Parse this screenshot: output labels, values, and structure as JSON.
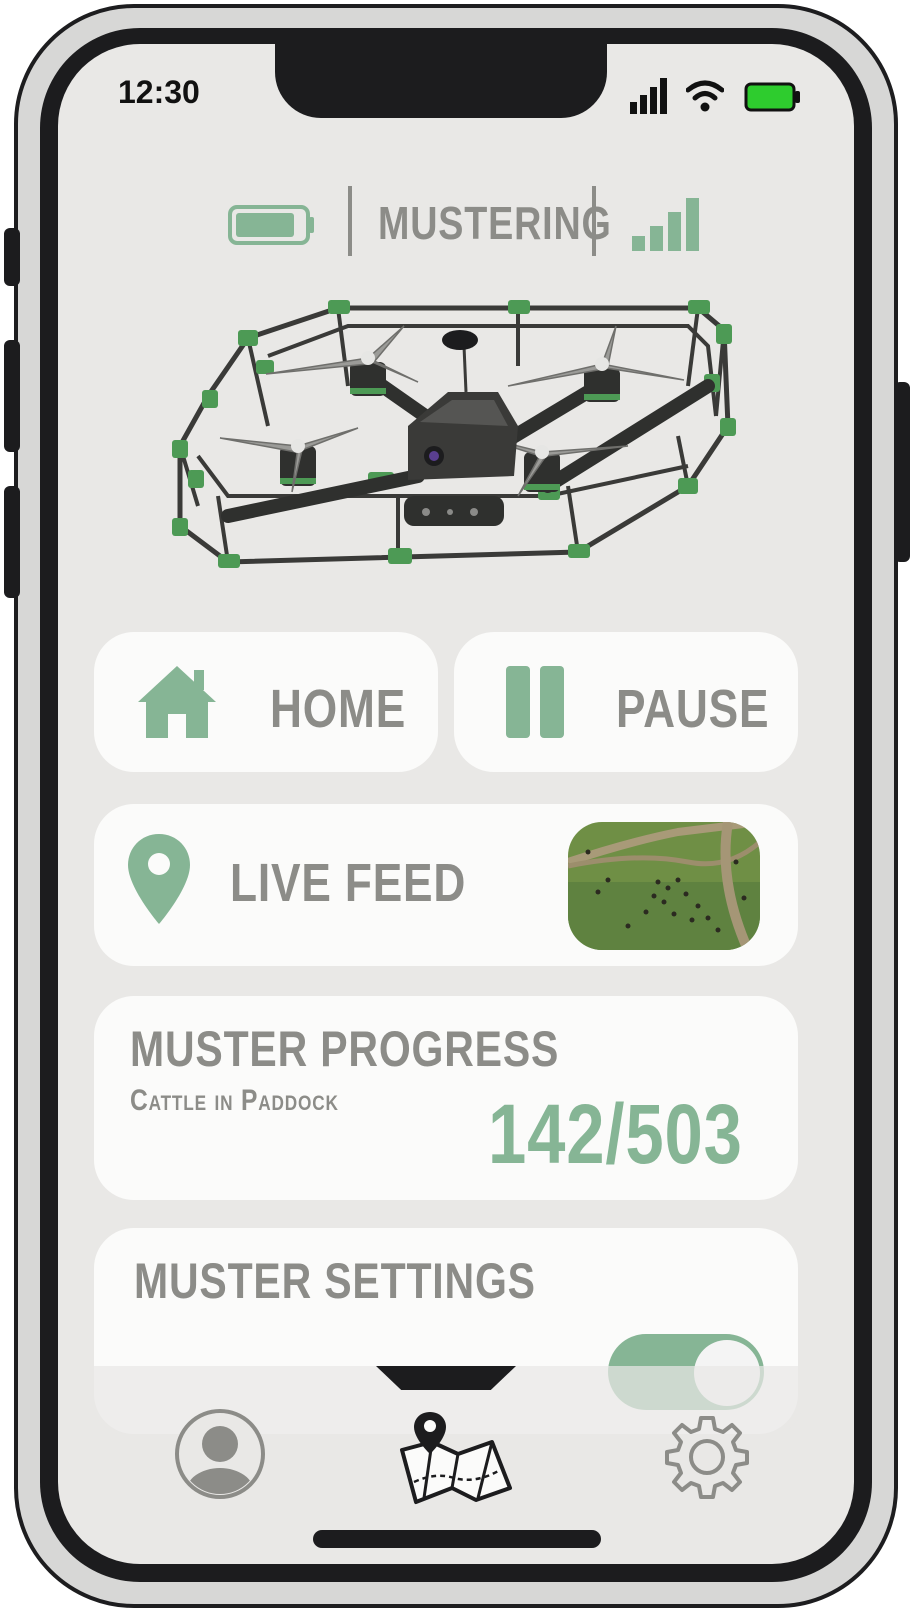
{
  "status_bar": {
    "time": "12:30"
  },
  "drone_header": {
    "mode": "MUSTERING"
  },
  "actions": {
    "home_label": "HOME",
    "pause_label": "PAUSE"
  },
  "live_feed": {
    "label": "LIVE FEED"
  },
  "progress": {
    "title": "MUSTER PROGRESS",
    "subtitle": "Cattle in Paddock",
    "count": "142/503"
  },
  "settings": {
    "title": "MUSTER SETTINGS",
    "toggle_on": true
  },
  "colors": {
    "accent": "#86b595",
    "text_gray": "#8c8c88",
    "battery_green": "#2ecc2e",
    "dark": "#1c1c1e"
  },
  "icons": {
    "status": [
      "cell-signal-icon",
      "wifi-icon",
      "battery-icon"
    ],
    "nav": [
      "profile-icon",
      "map-icon",
      "gear-icon"
    ]
  }
}
